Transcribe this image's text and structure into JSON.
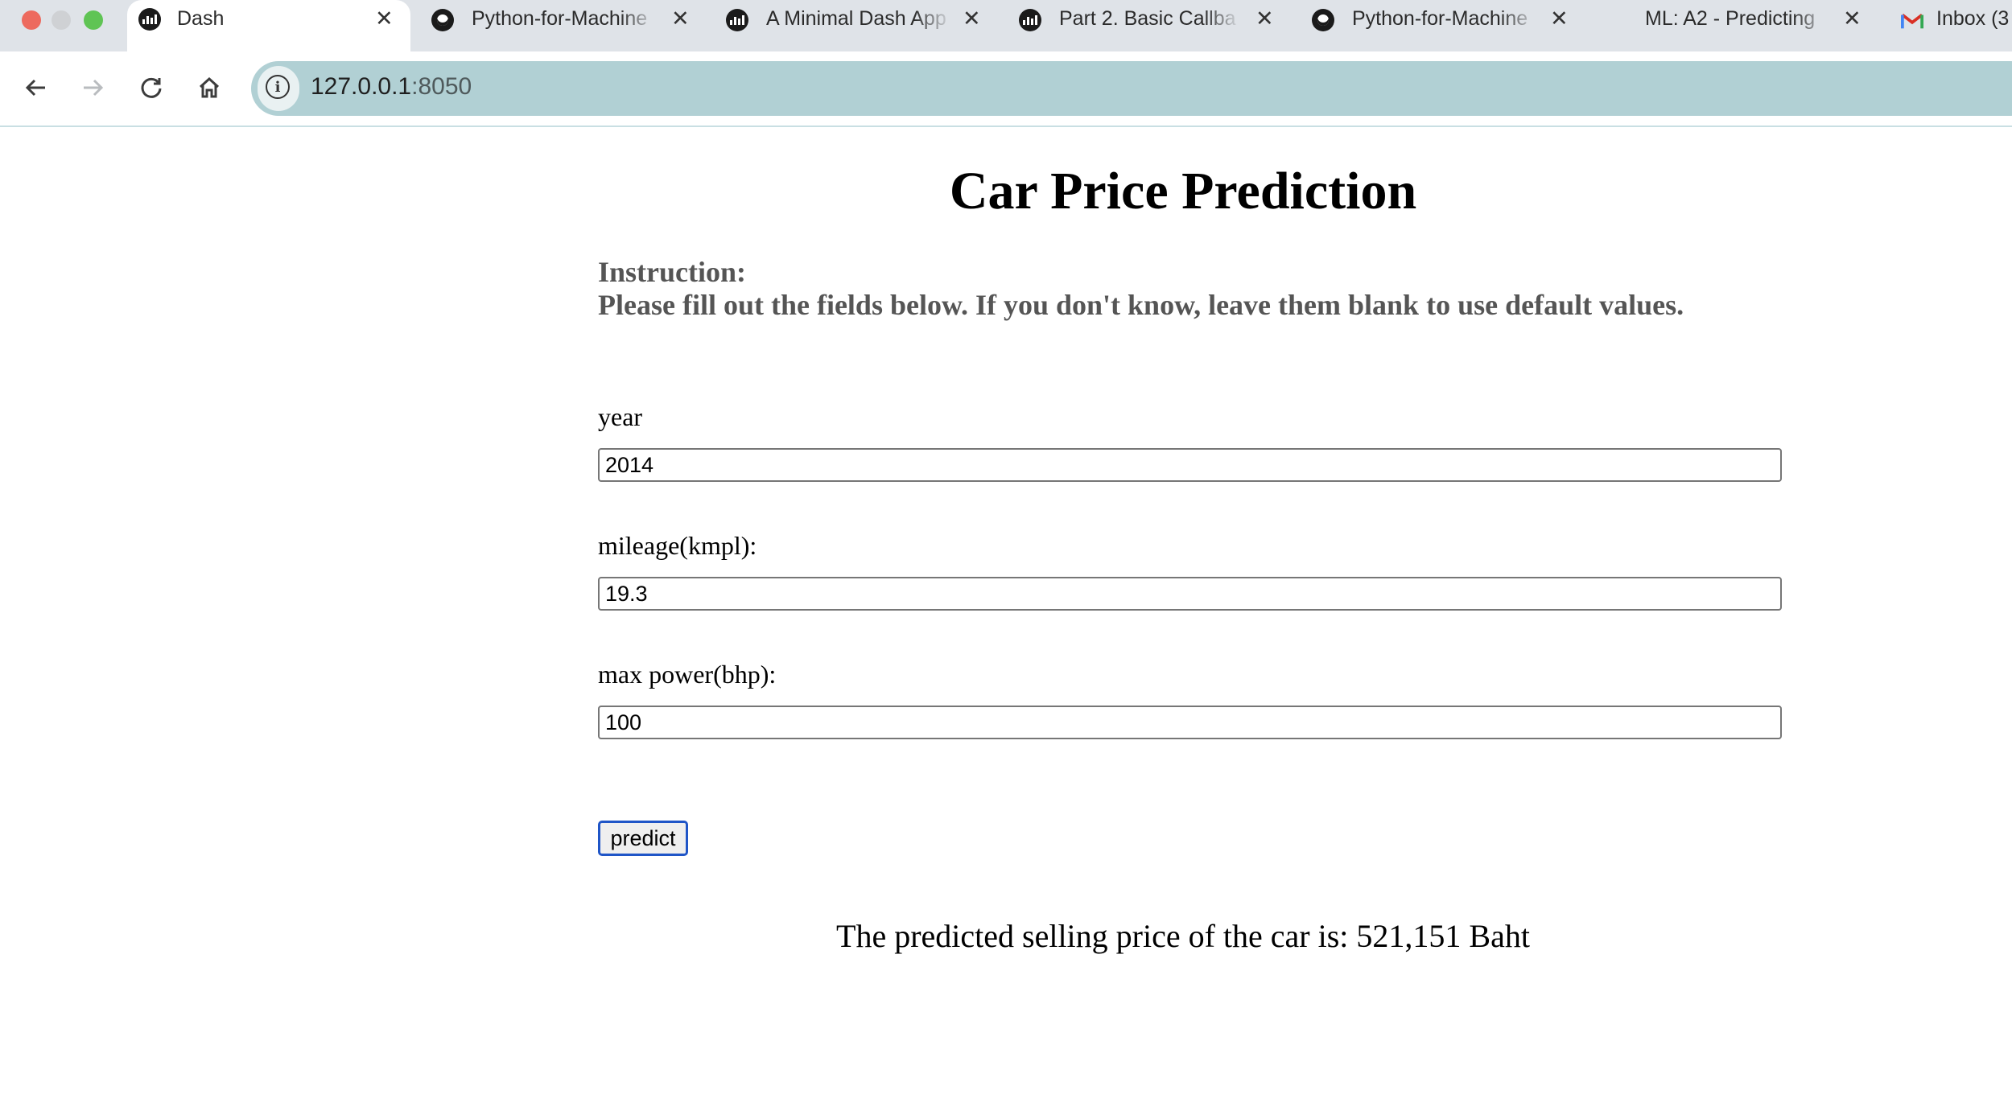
{
  "browser": {
    "tabs": [
      {
        "title": "Dash",
        "favicon": "dash-icon"
      },
      {
        "title": "Python-for-Machine",
        "favicon": "github-icon"
      },
      {
        "title": "A Minimal Dash App",
        "favicon": "dash-icon"
      },
      {
        "title": "Part 2. Basic Callba",
        "favicon": "dash-icon"
      },
      {
        "title": "Python-for-Machine",
        "favicon": "github-icon"
      },
      {
        "title": "ML: A2 - Predicting",
        "favicon": ""
      },
      {
        "title": "Inbox (3",
        "favicon": "gmail-icon"
      }
    ],
    "address": {
      "host": "127.0.0.1",
      "port": ":8050"
    }
  },
  "page": {
    "title": "Car Price Prediction",
    "instruction_heading": "Instruction:",
    "instruction_text": "Please fill out the fields below. If you don't know, leave them blank to use default values.",
    "fields": [
      {
        "label": "year",
        "value": "2014"
      },
      {
        "label": "mileage(kmpl):",
        "value": "19.3"
      },
      {
        "label": "max power(bhp):",
        "value": "100"
      }
    ],
    "predict_label": "predict",
    "result": "The predicted selling price of the car is: 521,151 Baht"
  },
  "colors": {
    "omnibox": "#b1d0d4",
    "button_border": "#1f55c7",
    "instruction_text": "#555555"
  }
}
